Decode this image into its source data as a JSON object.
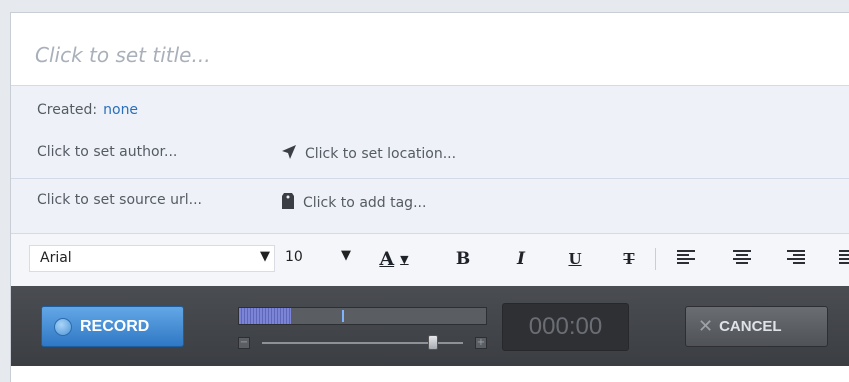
{
  "note": {
    "title_placeholder": "Click to set title..."
  },
  "meta": {
    "created_label": "Created:",
    "created_value": "none",
    "author_placeholder": "Click to set author...",
    "location_placeholder": "Click to set location...",
    "source_url_placeholder": "Click to set source url...",
    "tag_placeholder": "Click to add tag..."
  },
  "toolbar": {
    "font_family": "Arial",
    "font_size": "10",
    "text_color_label": "A",
    "bold_label": "B",
    "italic_label": "I",
    "underline_label": "U",
    "strike_label": "T",
    "icons": [
      "chevron-down-icon",
      "text-color-icon",
      "bold-icon",
      "italic-icon",
      "underline-icon",
      "strikethrough-icon",
      "align-left-icon",
      "align-center-icon",
      "align-right-icon",
      "justify-icon"
    ]
  },
  "recorder": {
    "record_label": "RECORD",
    "time": "000:00",
    "cancel_label": "CANCEL",
    "input_level": 0.21,
    "volume_level": 0.85,
    "colors": {
      "record_button": "#3e8ad6",
      "recorder_bar": "#434649",
      "level_fill": "#6f78cc"
    }
  },
  "colors": {
    "link_blue": "#2a6fb8",
    "meta_bg": "#eef2f8",
    "placeholder": "#a9b0ba"
  }
}
